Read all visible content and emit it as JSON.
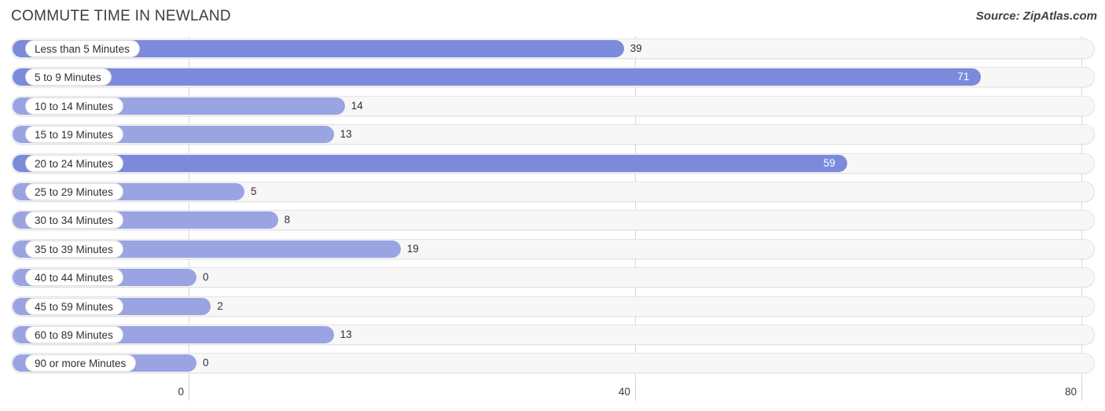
{
  "header": {
    "title": "COMMUTE TIME IN NEWLAND",
    "source": "Source: ZipAtlas.com"
  },
  "colors": {
    "bar_dark": "#7c8adb",
    "bar_light": "#9ba4e2",
    "track": "#f7f7f7",
    "grid": "#d8d8d8",
    "value_text": "#2f2f38",
    "value_text_inside": "#ffffff"
  },
  "chart_data": {
    "type": "bar",
    "orientation": "horizontal",
    "title": "COMMUTE TIME IN NEWLAND",
    "xlabel": "",
    "ylabel": "",
    "xlim": [
      0,
      80
    ],
    "xticks": [
      0,
      40,
      80
    ],
    "xtick_labels": [
      "0",
      "40",
      "80"
    ],
    "grid": true,
    "legend": false,
    "categories": [
      "Less than 5 Minutes",
      "5 to 9 Minutes",
      "10 to 14 Minutes",
      "15 to 19 Minutes",
      "20 to 24 Minutes",
      "25 to 29 Minutes",
      "30 to 34 Minutes",
      "35 to 39 Minutes",
      "40 to 44 Minutes",
      "45 to 59 Minutes",
      "60 to 89 Minutes",
      "90 or more Minutes"
    ],
    "values": [
      39,
      71,
      14,
      13,
      59,
      5,
      8,
      19,
      0,
      2,
      13,
      0
    ],
    "value_labels": [
      "39",
      "71",
      "14",
      "13",
      "59",
      "5",
      "8",
      "19",
      "0",
      "2",
      "13",
      "0"
    ],
    "shade": [
      "dark",
      "dark",
      "light",
      "light",
      "dark",
      "light",
      "light",
      "light",
      "light",
      "light",
      "light",
      "light"
    ],
    "label_inside": [
      false,
      true,
      false,
      false,
      true,
      false,
      false,
      false,
      false,
      false,
      false,
      false
    ]
  }
}
